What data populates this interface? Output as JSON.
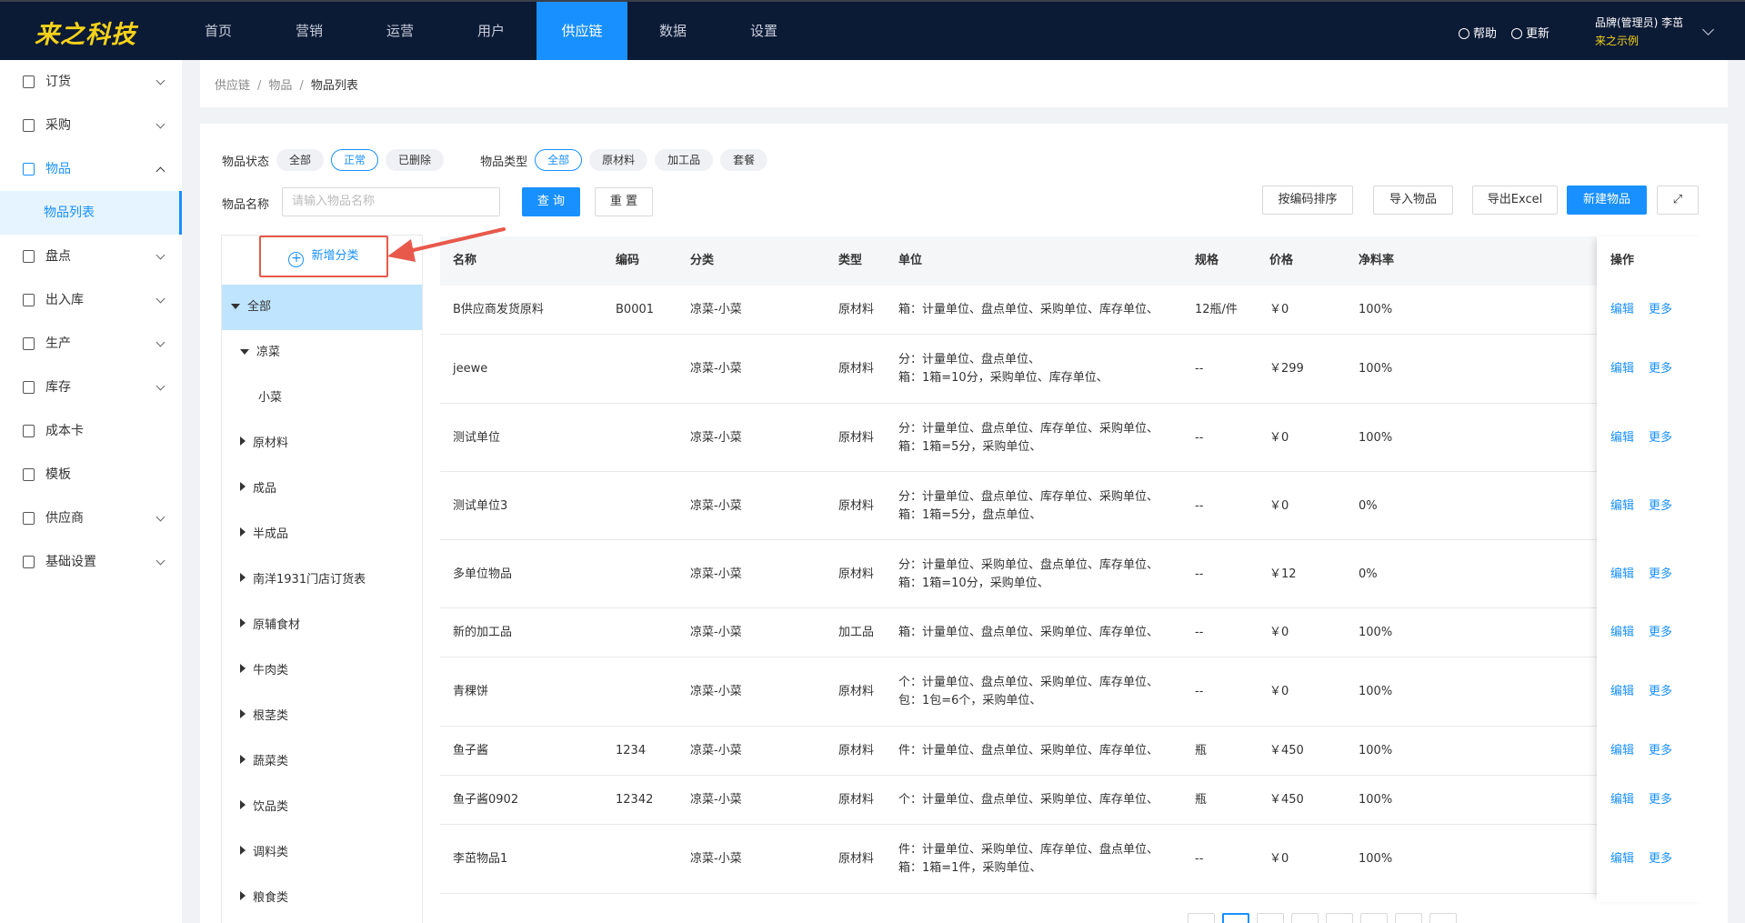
{
  "brand": {
    "logo": "来之科技"
  },
  "nav": [
    "首页",
    "营销",
    "运营",
    "用户",
    "供应链",
    "数据",
    "设置"
  ],
  "nav_active": 4,
  "header": {
    "help": "帮助",
    "update": "更新",
    "user_line1": "品牌(管理员)  李茁",
    "user_line2": "来之示例"
  },
  "sidebar": {
    "items": [
      "订货",
      "采购",
      "物品",
      "盘点",
      "出入库",
      "生产",
      "库存",
      "成本卡",
      "模板",
      "供应商",
      "基础设置"
    ],
    "open_item": 2,
    "sub_item": "物品列表"
  },
  "breadcrumb": [
    "供应链",
    "物品",
    "物品列表"
  ],
  "filters": {
    "status_label": "物品状态",
    "status_options": [
      "全部",
      "正常",
      "已删除"
    ],
    "status_selected": 1,
    "type_label": "物品类型",
    "type_options": [
      "全部",
      "原材料",
      "加工品",
      "套餐"
    ],
    "type_selected": 0,
    "name_label": "物品名称",
    "name_placeholder": "请输入物品名称"
  },
  "buttons": {
    "query": "查 询",
    "reset": "重 置",
    "sort_by_code": "按编码排序",
    "import": "导入物品",
    "export": "导出Excel",
    "create": "新建物品"
  },
  "tree": {
    "add_category": "新增分类",
    "nodes": [
      "全部",
      "凉菜",
      "小菜",
      "原材料",
      "成品",
      "半成品",
      "南洋1931门店订货表",
      "原辅食材",
      "牛肉类",
      "根茎类",
      "蔬菜类",
      "饮品类",
      "调料类",
      "粮食类"
    ]
  },
  "table": {
    "columns": [
      "名称",
      "编码",
      "分类",
      "类型",
      "单位",
      "规格",
      "价格",
      "净料率",
      "操作"
    ],
    "op_edit": "编辑",
    "op_more": "更多",
    "rows": [
      {
        "name": "B供应商发货原料",
        "code": "B0001",
        "category": "凉菜-小菜",
        "type": "原材料",
        "unit1": "箱：计量单位、盘点单位、采购单位、库存单位、",
        "unit2": "",
        "spec": "12瓶/件",
        "price": "￥0",
        "yield": "100%"
      },
      {
        "name": "jeewe",
        "code": "",
        "category": "凉菜-小菜",
        "type": "原材料",
        "unit1": "分：计量单位、盘点单位、",
        "unit2": "箱：1箱=10分，采购单位、库存单位、",
        "spec": "--",
        "price": "￥299",
        "yield": "100%"
      },
      {
        "name": "测试单位",
        "code": "",
        "category": "凉菜-小菜",
        "type": "原材料",
        "unit1": "分：计量单位、盘点单位、库存单位、采购单位、",
        "unit2": "箱：1箱=5分，采购单位、",
        "spec": "--",
        "price": "￥0",
        "yield": "100%"
      },
      {
        "name": "测试单位3",
        "code": "",
        "category": "凉菜-小菜",
        "type": "原材料",
        "unit1": "分：计量单位、盘点单位、库存单位、采购单位、",
        "unit2": "箱：1箱=5分，盘点单位、",
        "spec": "--",
        "price": "￥0",
        "yield": "0%"
      },
      {
        "name": "多单位物品",
        "code": "",
        "category": "凉菜-小菜",
        "type": "原材料",
        "unit1": "分：计量单位、采购单位、盘点单位、库存单位、",
        "unit2": "箱：1箱=10分，采购单位、",
        "spec": "--",
        "price": "￥12",
        "yield": "0%"
      },
      {
        "name": "新的加工品",
        "code": "",
        "category": "凉菜-小菜",
        "type": "加工品",
        "unit1": "箱：计量单位、盘点单位、采购单位、库存单位、",
        "unit2": "",
        "spec": "--",
        "price": "￥0",
        "yield": "100%"
      },
      {
        "name": "青稞饼",
        "code": "",
        "category": "凉菜-小菜",
        "type": "原材料",
        "unit1": "个：计量单位、盘点单位、采购单位、库存单位、",
        "unit2": "包：1包=6个，采购单位、",
        "spec": "--",
        "price": "￥0",
        "yield": "100%"
      },
      {
        "name": "鱼子酱",
        "code": "1234",
        "category": "凉菜-小菜",
        "type": "原材料",
        "unit1": "件：计量单位、盘点单位、采购单位、库存单位、",
        "unit2": "",
        "spec": "瓶",
        "price": "￥450",
        "yield": "100%"
      },
      {
        "name": "鱼子酱0902",
        "code": "12342",
        "category": "凉菜-小菜",
        "type": "原材料",
        "unit1": "个：计量单位、盘点单位、采购单位、库存单位、",
        "unit2": "",
        "spec": "瓶",
        "price": "￥450",
        "yield": "100%"
      },
      {
        "name": "李茁物品1",
        "code": "",
        "category": "凉菜-小菜",
        "type": "原材料",
        "unit1": "件：计量单位、采购单位、库存单位、盘点单位、",
        "unit2": "箱：1箱=1件，采购单位、",
        "spec": "--",
        "price": "￥0",
        "yield": "100%"
      }
    ]
  },
  "colors": {
    "primary": "#1890ff",
    "topbar": "#0b1a35",
    "logo": "#f5d21a",
    "highlight": "#e8594c"
  }
}
